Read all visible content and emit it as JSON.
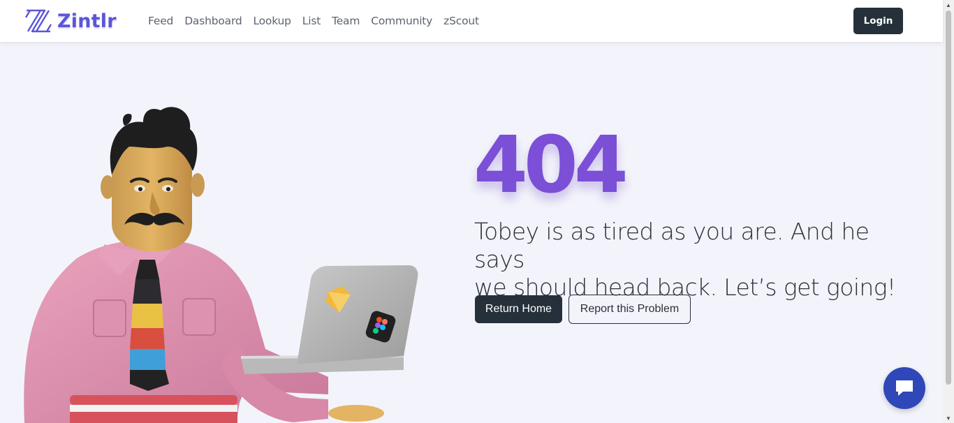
{
  "header": {
    "brand_name": "Zintlr",
    "nav": [
      "Feed",
      "Dashboard",
      "Lookup",
      "List",
      "Team",
      "Community",
      "zScout"
    ],
    "login_label": "Login"
  },
  "error": {
    "code": "404",
    "message_line1": "Tobey is as tired as you are. And he says",
    "message_line2": "we should head back. Let’s get going!"
  },
  "actions": {
    "return_home": "Return Home",
    "report_problem": "Report this Problem"
  },
  "chat": {
    "icon": "chat-bubble-icon"
  },
  "colors": {
    "brand": "#5b55d9",
    "error_code": "#7b4fd6",
    "dark_button": "#25303a",
    "chat_button": "#2f47b8",
    "page_background": "#f3f4fb"
  }
}
